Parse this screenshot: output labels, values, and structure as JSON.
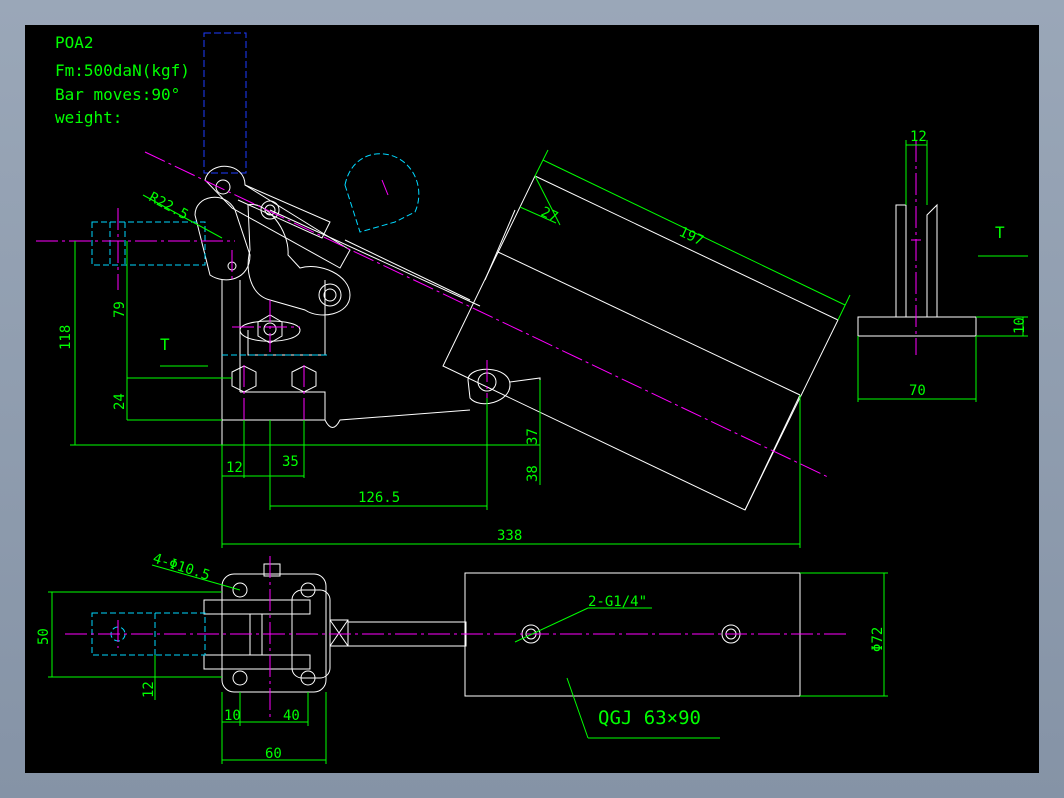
{
  "info": {
    "model": "POA2",
    "force": "Fm:500daN(kgf)",
    "bar_moves": "Bar moves:90°",
    "weight": "weight:"
  },
  "dims": {
    "r22_5": "R22.5",
    "d27": "27",
    "d197": "197",
    "d12_top": "12",
    "t_right": "T",
    "d10": "10",
    "d70": "70",
    "d118": "118",
    "d79": "79",
    "t_left": "T",
    "d24": "24",
    "d12_a": "12",
    "d35": "35",
    "d37": "37",
    "d38": "38",
    "d126_5": "126.5",
    "d338": "338",
    "holes": "4-Φ10.5",
    "d50": "50",
    "d12_b": "12",
    "d10_b": "10",
    "d40": "40",
    "d60": "60",
    "g1_4": "2-G1/4\"",
    "phi72": "Φ72",
    "cylinder": "QGJ 63×90"
  },
  "colors": {
    "background": "#000000",
    "outline": "#ffffff",
    "dimension": "#00ff00",
    "centerline": "#ff00ff",
    "hidden_cyan": "#00d8ff",
    "hidden_blue": "#1e3cff"
  }
}
